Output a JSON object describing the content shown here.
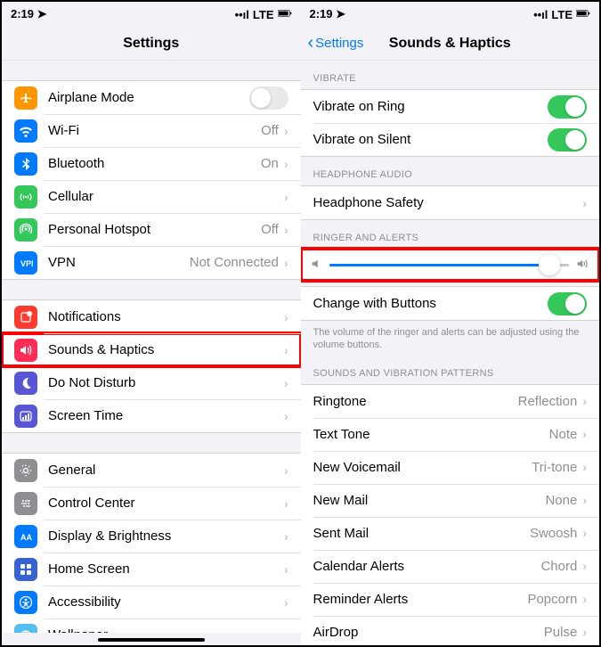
{
  "status": {
    "time": "2:19",
    "carrier_label": "LTE"
  },
  "left": {
    "title": "Settings",
    "groups": [
      {
        "rows": [
          {
            "icon": "airplane",
            "color": "#ff9500",
            "label": "Airplane Mode",
            "control": "toggle-off"
          },
          {
            "icon": "wifi",
            "color": "#007aff",
            "label": "Wi-Fi",
            "value": "Off",
            "control": "chevron"
          },
          {
            "icon": "bluetooth",
            "color": "#007aff",
            "label": "Bluetooth",
            "value": "On",
            "control": "chevron"
          },
          {
            "icon": "cellular",
            "color": "#34c759",
            "label": "Cellular",
            "control": "chevron"
          },
          {
            "icon": "hotspot",
            "color": "#34c759",
            "label": "Personal Hotspot",
            "value": "Off",
            "control": "chevron"
          },
          {
            "icon": "vpn",
            "color": "#007aff",
            "label": "VPN",
            "value": "Not Connected",
            "control": "chevron"
          }
        ]
      },
      {
        "rows": [
          {
            "icon": "notif",
            "color": "#ff3b30",
            "label": "Notifications",
            "control": "chevron"
          },
          {
            "icon": "sounds",
            "color": "#ff2d55",
            "label": "Sounds & Haptics",
            "control": "chevron",
            "highlight": true
          },
          {
            "icon": "dnd",
            "color": "#5856d6",
            "label": "Do Not Disturb",
            "control": "chevron"
          },
          {
            "icon": "screentime",
            "color": "#5856d6",
            "label": "Screen Time",
            "control": "chevron"
          }
        ]
      },
      {
        "rows": [
          {
            "icon": "general",
            "color": "#8e8e93",
            "label": "General",
            "control": "chevron"
          },
          {
            "icon": "control",
            "color": "#8e8e93",
            "label": "Control Center",
            "control": "chevron"
          },
          {
            "icon": "display",
            "color": "#007aff",
            "label": "Display & Brightness",
            "control": "chevron"
          },
          {
            "icon": "home",
            "color": "#3763d1",
            "label": "Home Screen",
            "control": "chevron"
          },
          {
            "icon": "accessibility",
            "color": "#007aff",
            "label": "Accessibility",
            "control": "chevron"
          },
          {
            "icon": "wallpaper",
            "color": "#55bef0",
            "label": "Wallpaper",
            "control": "chevron"
          }
        ]
      }
    ]
  },
  "right": {
    "back": "Settings",
    "title": "Sounds & Haptics",
    "section_vibrate": "VIBRATE",
    "vibrate_ring": "Vibrate on Ring",
    "vibrate_silent": "Vibrate on Silent",
    "section_headphone": "HEADPHONE AUDIO",
    "headphone_safety": "Headphone Safety",
    "section_ringer": "RINGER AND ALERTS",
    "slider_value": 92,
    "change_buttons": "Change with Buttons",
    "footer_text": "The volume of the ringer and alerts can be adjusted using the volume buttons.",
    "section_patterns": "SOUNDS AND VIBRATION PATTERNS",
    "patterns": [
      {
        "label": "Ringtone",
        "value": "Reflection"
      },
      {
        "label": "Text Tone",
        "value": "Note"
      },
      {
        "label": "New Voicemail",
        "value": "Tri-tone"
      },
      {
        "label": "New Mail",
        "value": "None"
      },
      {
        "label": "Sent Mail",
        "value": "Swoosh"
      },
      {
        "label": "Calendar Alerts",
        "value": "Chord"
      },
      {
        "label": "Reminder Alerts",
        "value": "Popcorn"
      },
      {
        "label": "AirDrop",
        "value": "Pulse"
      }
    ]
  }
}
